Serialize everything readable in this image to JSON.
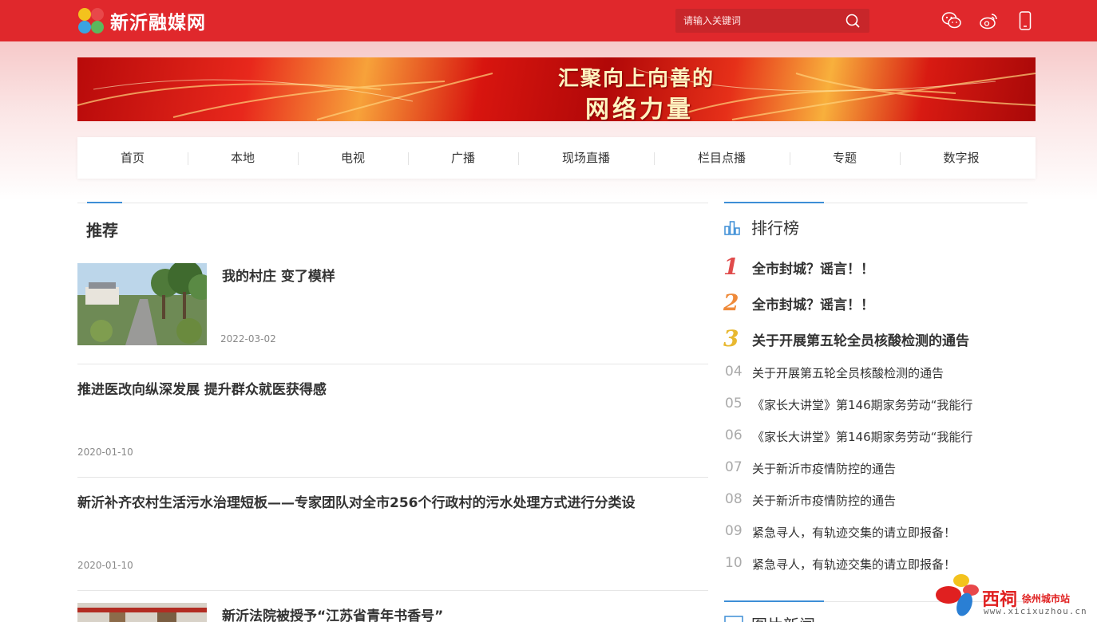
{
  "header": {
    "site_name": "新沂融媒网",
    "search_placeholder": "请输入关键词",
    "icons": [
      "wechat-icon",
      "weibo-icon",
      "mobile-icon"
    ]
  },
  "banner": {
    "line1": "汇聚向上向善的",
    "line2": "网络力量"
  },
  "nav": {
    "items": [
      "首页",
      "本地",
      "电视",
      "广播",
      "现场直播",
      "栏目点播",
      "专题",
      "数字报"
    ]
  },
  "recommend": {
    "title": "推荐",
    "articles": [
      {
        "title": "我的村庄 变了模样",
        "date": "2022-03-02",
        "has_image": true
      },
      {
        "title": "推进医改向纵深发展 提升群众就医获得感",
        "date": "2020-01-10",
        "has_image": false
      },
      {
        "title": "新沂补齐农村生活污水治理短板——专家团队对全市256个行政村的污水处理方式进行分类设",
        "date": "2020-01-10",
        "has_image": false
      },
      {
        "title": "新沂法院被授予“江苏省青年书香号”",
        "date": "",
        "has_image": true
      }
    ]
  },
  "ranking": {
    "title": "排行榜",
    "items": [
      {
        "num": "1",
        "text": "全市封城？谣言！！"
      },
      {
        "num": "2",
        "text": "全市封城？谣言！！"
      },
      {
        "num": "3",
        "text": "关于开展第五轮全员核酸检测的通告"
      },
      {
        "num": "04",
        "text": "关于开展第五轮全员核酸检测的通告"
      },
      {
        "num": "05",
        "text": "《家长大讲堂》第146期家务劳动“我能行"
      },
      {
        "num": "06",
        "text": "《家长大讲堂》第146期家务劳动“我能行"
      },
      {
        "num": "07",
        "text": "关于新沂市疫情防控的通告"
      },
      {
        "num": "08",
        "text": "关于新沂市疫情防控的通告"
      },
      {
        "num": "09",
        "text": "紧急寻人，有轨迹交集的请立即报备！"
      },
      {
        "num": "10",
        "text": "紧急寻人，有轨迹交集的请立即报备！"
      }
    ]
  },
  "picture_news": {
    "title": "图片新闻"
  },
  "watermark": {
    "name": "西祠",
    "city": "徐州城市站",
    "url": "www.xicixuzhou.cn"
  },
  "colors": {
    "brand_red": "#e0282c",
    "accent_blue": "#3d8ed6",
    "rank1": "#e04b4b",
    "rank2": "#ef8a3a",
    "rank3": "#e8b830"
  }
}
